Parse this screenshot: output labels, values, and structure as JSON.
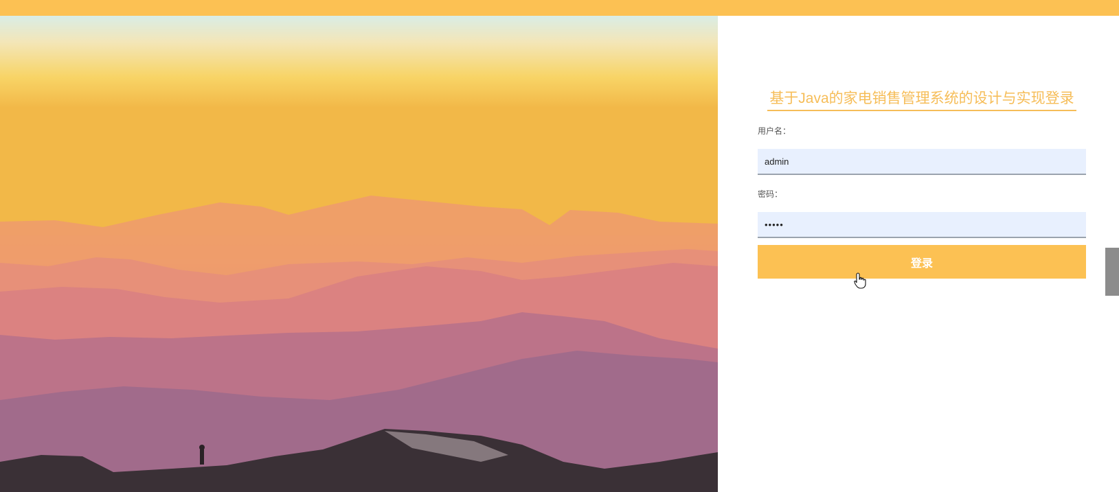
{
  "colors": {
    "accent": "#fcc153",
    "title": "#f6bd58",
    "input_bg": "#e8f0fe"
  },
  "login": {
    "title": "基于Java的家电销售管理系统的设计与实现登录",
    "username_label": "用户名：",
    "username_value": "admin",
    "password_label": "密码：",
    "password_value": "•••••",
    "submit_label": "登录"
  },
  "icons": {
    "cursor": "hand-pointer-icon"
  }
}
